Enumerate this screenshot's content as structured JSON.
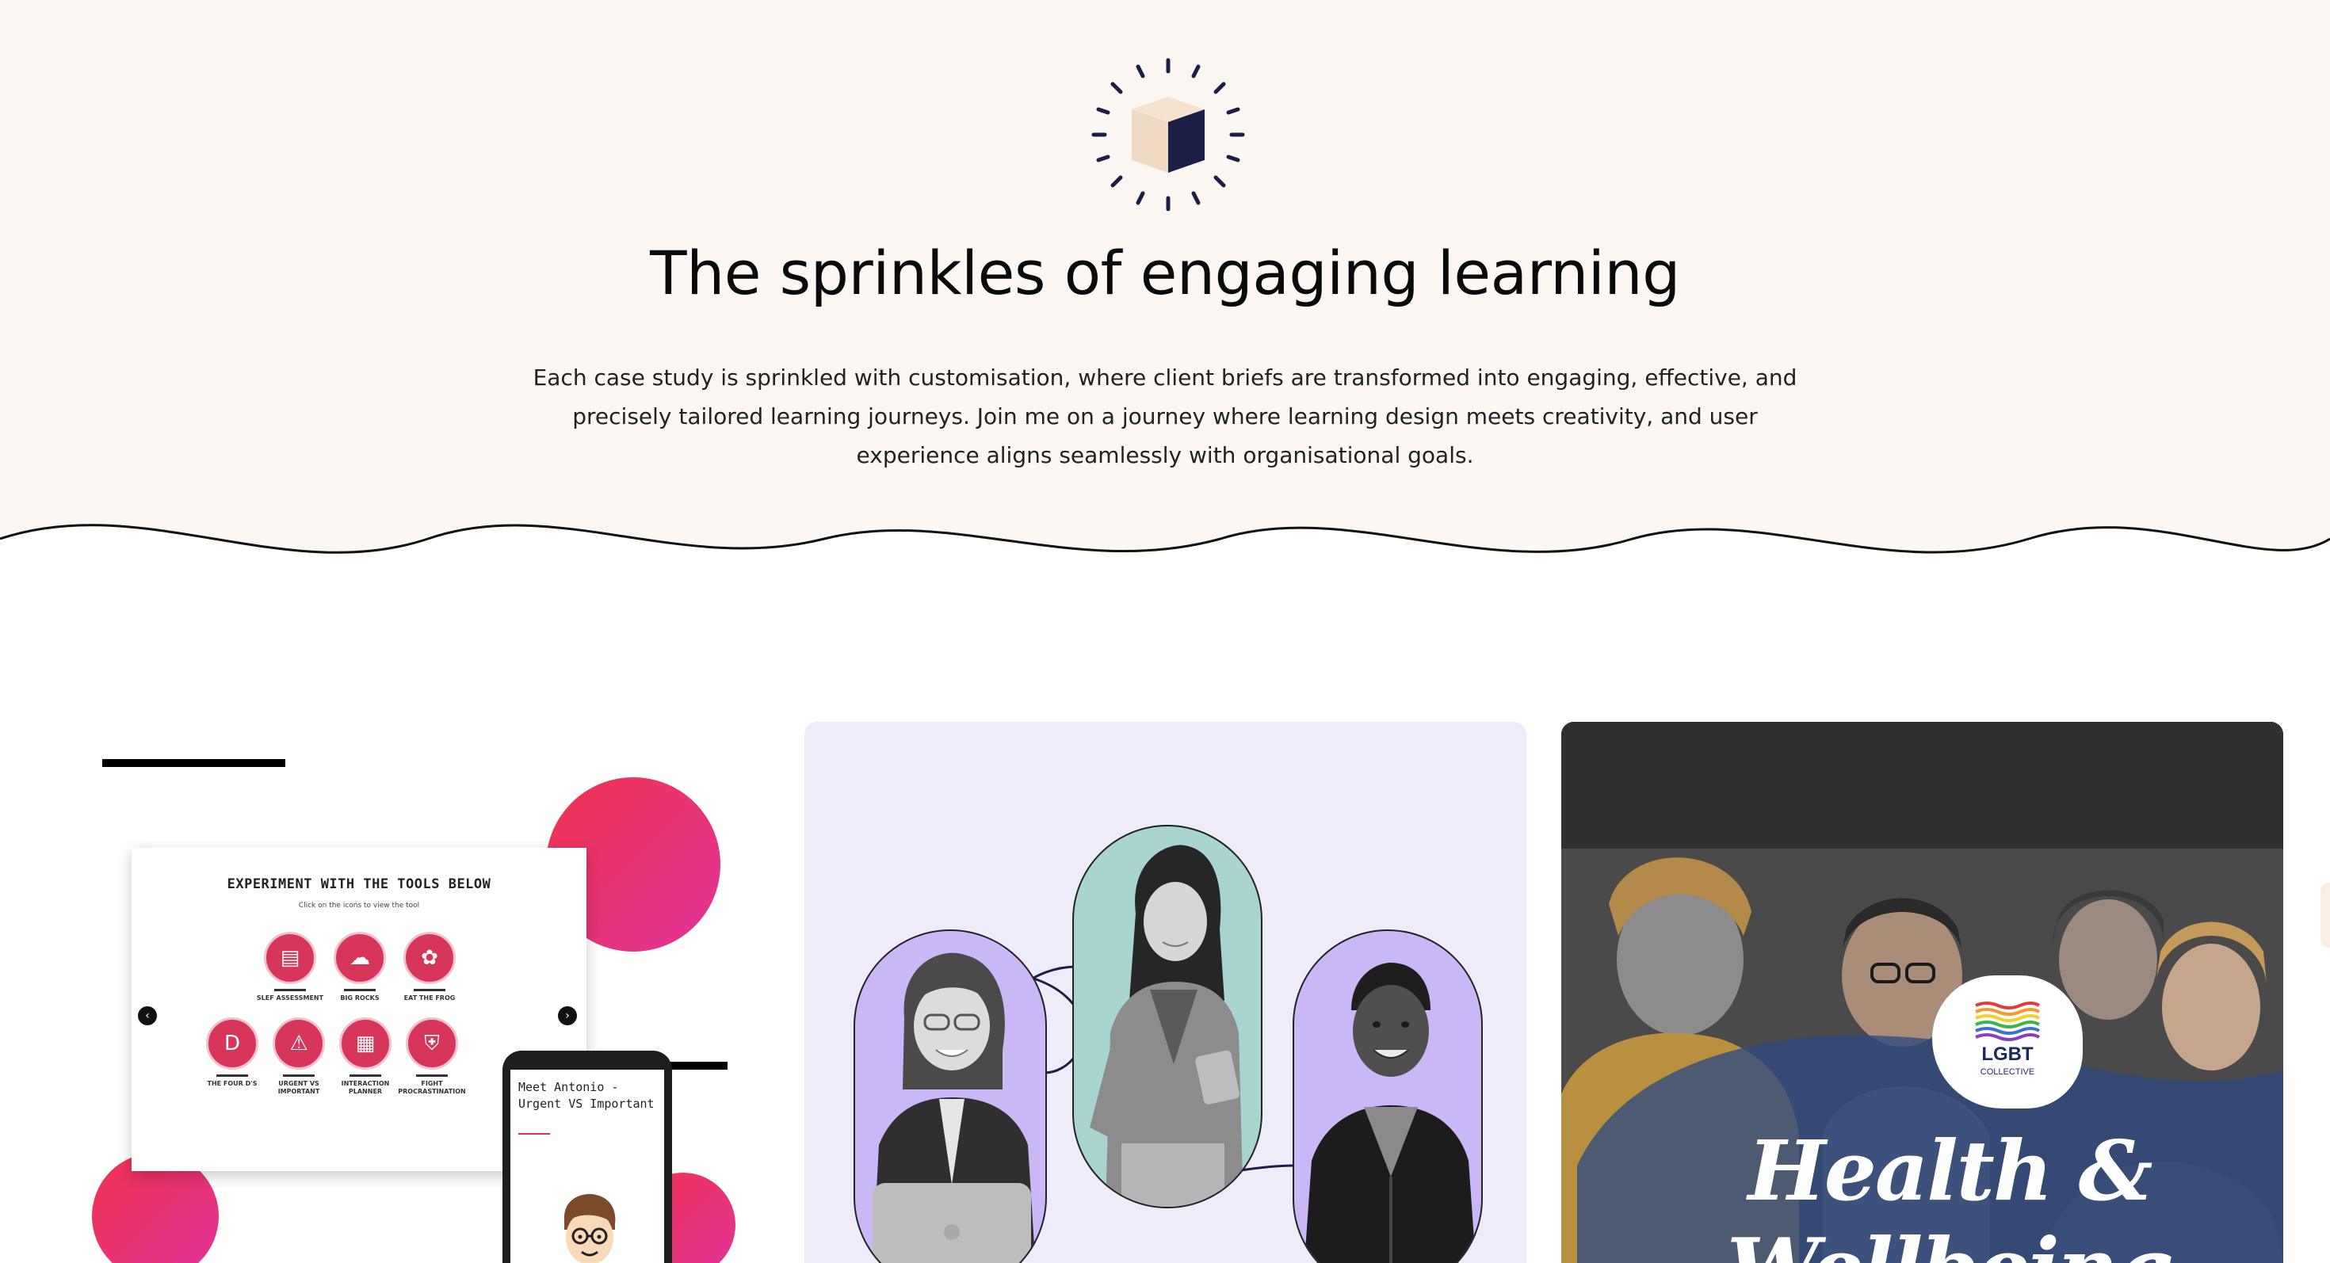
{
  "hero": {
    "title": "The sprinkles of engaging learning",
    "description": "Each case study is sprinkled with customisation, where client briefs are transformed into engaging, effective, and precisely tailored learning journeys. Join me on a journey where learning design meets creativity, and user experience aligns seamlessly with organisational goals."
  },
  "colors": {
    "hero_bg": "#fcf7f2",
    "accent_pink": "#d7365a",
    "card2_bg": "#efecfa",
    "pill_purple": "#c9b8f5",
    "pill_teal": "#a8d5cf",
    "navy": "#1b1f45",
    "cube_beige": "#f0d9c2"
  },
  "case1": {
    "slide_title": "EXPERIMENT WITH THE TOOLS BELOW",
    "slide_subtitle": "Click on the icons to view the tool",
    "tools": [
      {
        "label": "SLEF ASSESSMENT",
        "icon": "checklist-icon"
      },
      {
        "label": "BIG ROCKS",
        "icon": "rocks-icon"
      },
      {
        "label": "EAT THE FROG",
        "icon": "frog-icon"
      },
      {
        "label": "THE FOUR D'S",
        "icon": "letter-d-icon",
        "glyph": "D"
      },
      {
        "label": "URGENT VS IMPORTANT",
        "icon": "alarm-icon"
      },
      {
        "label": "INTERACTION PLANNER",
        "icon": "calendar-icon"
      },
      {
        "label": "FIGHT PROCRASTINATION",
        "icon": "shield-icon"
      }
    ],
    "phone_text": "Meet Antonio - Urgent VS Important"
  },
  "case3": {
    "badge_title": "LGBT",
    "badge_subtitle": "COLLECTIVE",
    "headline": "Health & Wellbeing"
  }
}
